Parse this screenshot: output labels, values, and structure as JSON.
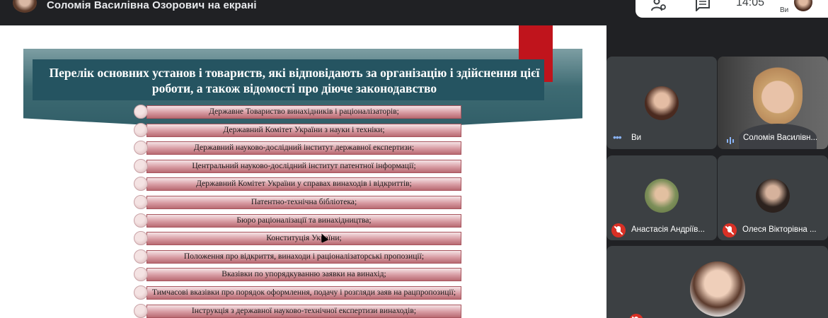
{
  "topbar": {
    "presenter_text": "Соломія Василівна Озорович на екрані",
    "clock": "14:05",
    "you_label": "Ви"
  },
  "slide": {
    "title": "Перелік основних установ і товариств, які відповідають за організацію і здійснення цієї роботи, а також відомості про діюче законодавство",
    "items": [
      "Державне Товариство винахідників і раціоналізаторів;",
      "Державний Комітет України з науки і техніки;",
      "Державний науково-дослідний інститут державної експертизи;",
      "Центральний науково-дослідний інститут патентної інформації;",
      "Державний Комітет України у справах винаходів і відкриттів;",
      "Патентно-технічна бібліотека;",
      "Бюро раціоналізації та винахідництва;",
      "Конституція України;",
      "Положення про відкриття, винаходи і раціоналізаторські пропозиції;",
      "Вказівки по упорядкуванню заявки на винахід;",
      "Тимчасові вказівки про порядок оформлення, подачу і розгляди заяв на рацпропозиції;",
      "Інструкція з державної науково-технічної експертизи винаходів;"
    ]
  },
  "participants": {
    "you": "Ви",
    "presenter": "Соломія Василівн...",
    "p3": "Анастасія Андріїв...",
    "p4": "Олеся Вікторівна ..."
  },
  "colors": {
    "meet_bg": "#202124",
    "tile_bg": "#3c4043",
    "mic_off": "#d93025",
    "slide_teal": "#255461",
    "accent_red": "#c0141c"
  }
}
